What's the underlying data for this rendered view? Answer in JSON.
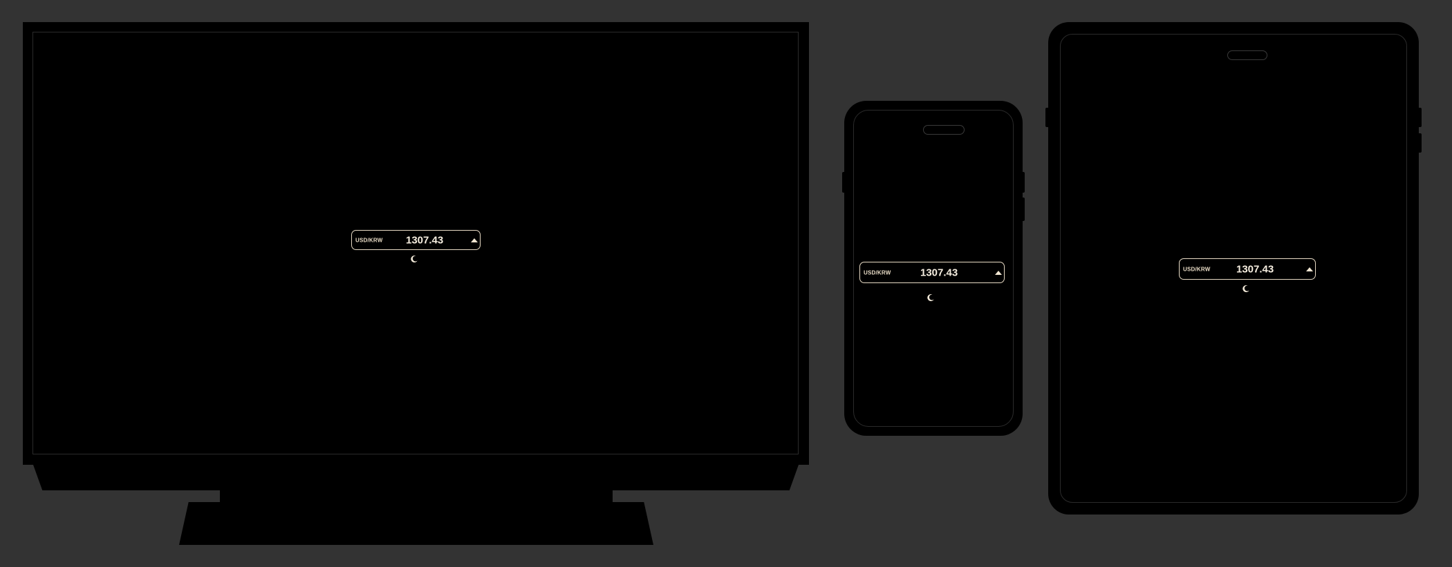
{
  "widget": {
    "pair_label": "USD/KRW",
    "rate": "1307.43",
    "trend_icon": "triangle-up-icon",
    "theme_toggle_icon": "moon-icon"
  },
  "colors": {
    "background": "#333333",
    "device": "#000000",
    "widget_border": "#e9dcc6",
    "widget_text": "#f6eee0"
  }
}
